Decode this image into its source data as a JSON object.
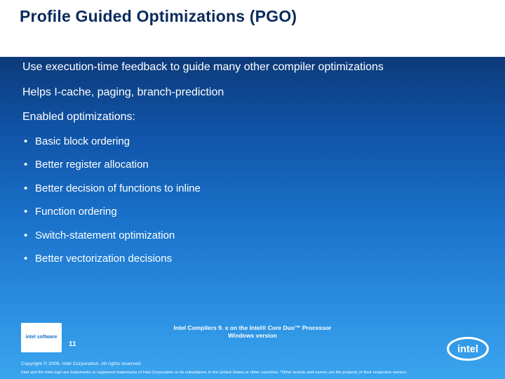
{
  "title": "Profile Guided Optimizations (PGO)",
  "paragraphs": [
    "Use execution-time feedback to guide many other compiler optimizations",
    "Helps I-cache, paging, branch-prediction",
    "Enabled optimizations:"
  ],
  "bullets": [
    "Basic block ordering",
    "Better register allocation",
    "Better decision of functions to inline",
    "Function ordering",
    "Switch-statement optimization",
    "Better vectorization decisions"
  ],
  "footer_event": {
    "line1": "Intel Compilers 9. x on the Intel® Core Duo™ Processor",
    "line2": "Windows version"
  },
  "page_number": "11",
  "badge_text": "intel software",
  "copyright": "Copyright © 2006, Intel Corporation. All rights reserved.",
  "trademark": "Intel and the Intel logo are trademarks or registered trademarks of Intel Corporation or its subsidiaries in the United States or other countries. *Other brands and names are the property of their respective owners.",
  "logo_label": "intel"
}
